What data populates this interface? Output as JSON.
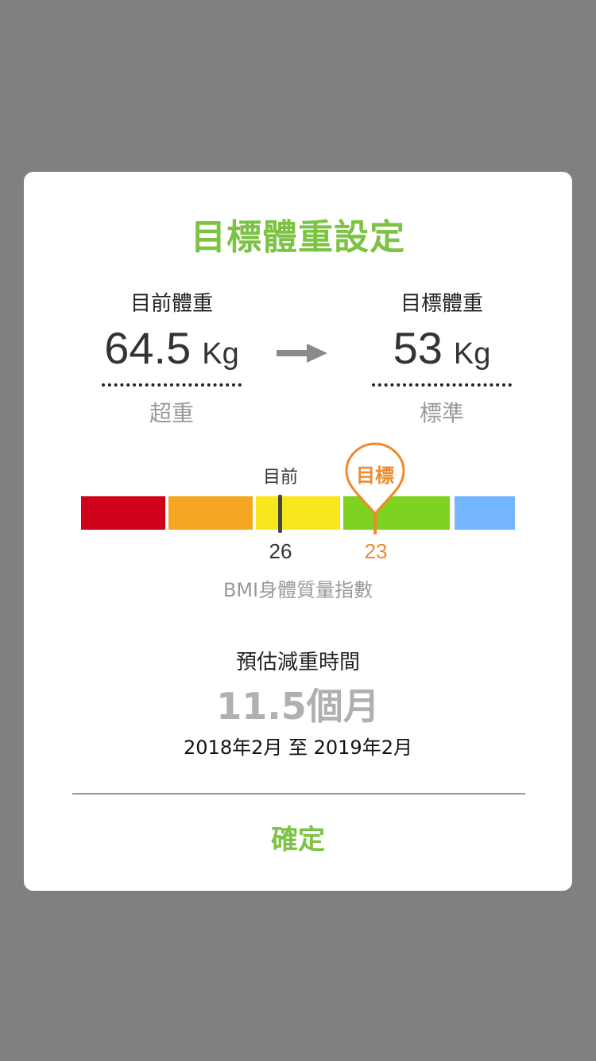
{
  "dialog": {
    "title": "目標體重設定",
    "current": {
      "label": "目前體重",
      "value": "64.5",
      "unit": "Kg",
      "status": "超重"
    },
    "target": {
      "label": "目標體重",
      "value": "53",
      "unit": "Kg",
      "status": "標準"
    },
    "arrow_icon": "right-arrow-icon",
    "bmi": {
      "current_marker_label": "目前",
      "target_marker_label": "目標",
      "current_value": "26",
      "target_value": "23",
      "caption": "BMI身體質量指數",
      "segment_colors": [
        "#d0021b",
        "#f5a623",
        "#f8e71c",
        "#7ed321",
        "#74b5ff"
      ],
      "marker_color": "#444444",
      "target_color": "#f08a2c"
    },
    "estimate": {
      "label": "預估減重時間",
      "value": "11.5個月",
      "range": "2018年2月 至 2019年2月"
    },
    "confirm_label": "確定",
    "accent_color": "#7cc243"
  }
}
